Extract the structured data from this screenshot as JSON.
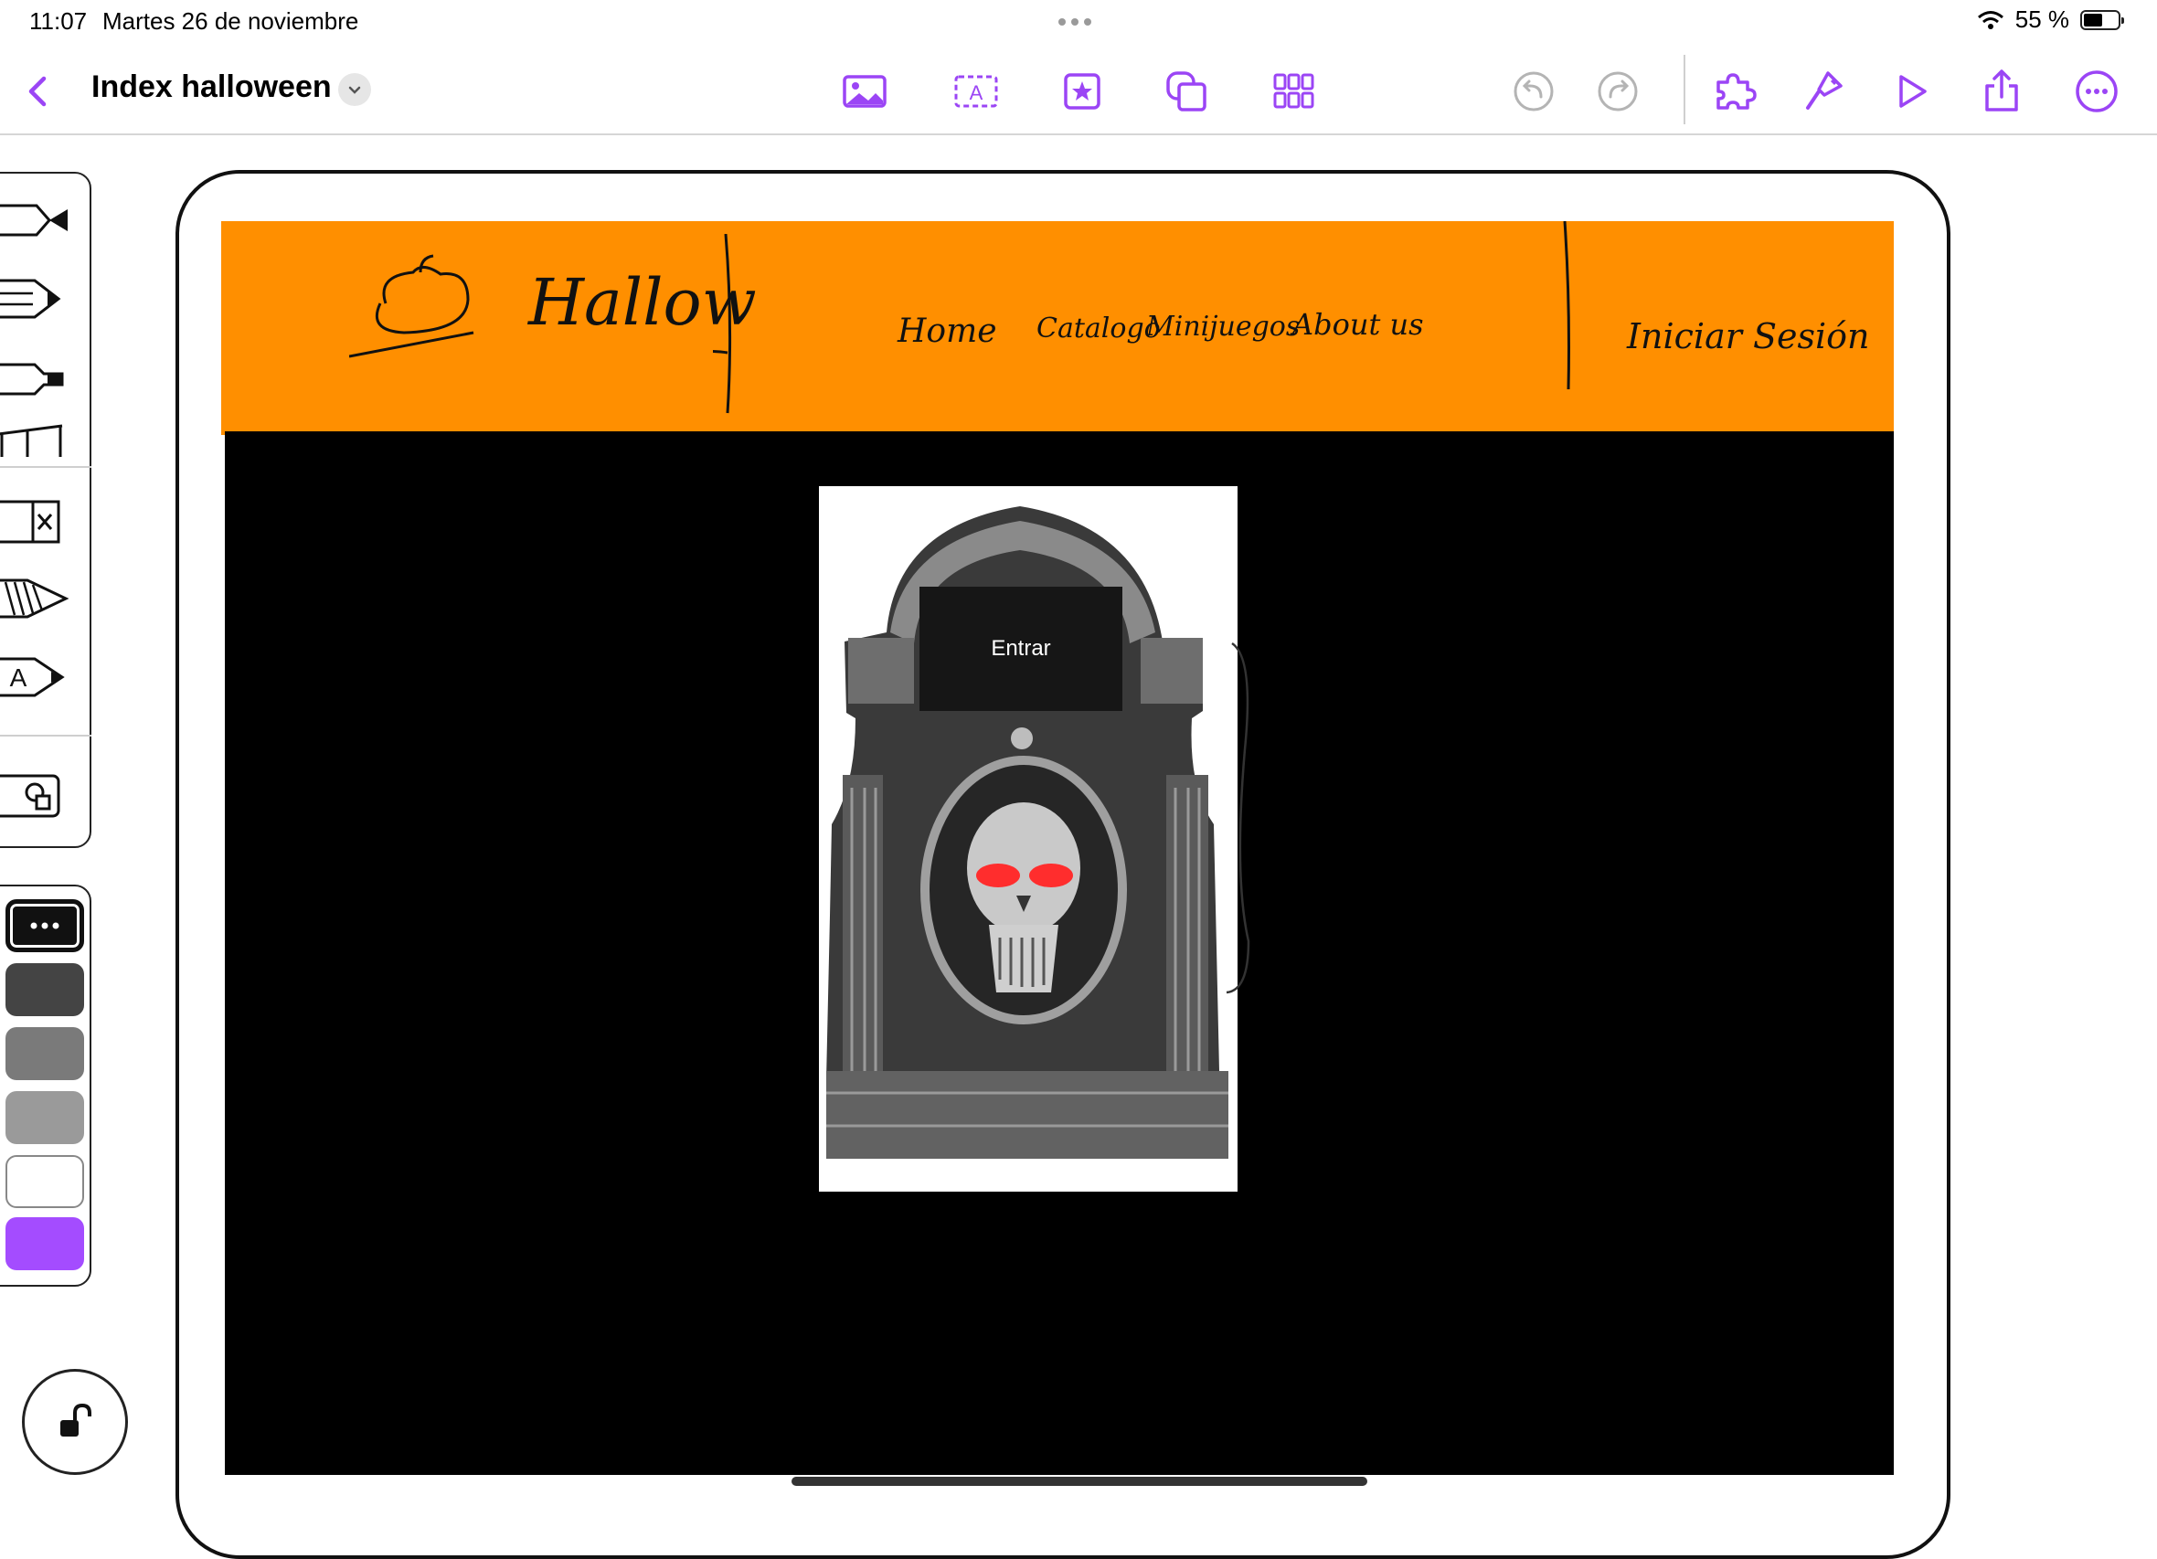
{
  "status_bar": {
    "time": "11:07",
    "date": "Martes 26 de noviembre",
    "battery": "55 %",
    "battery_level": 0.55
  },
  "toolbar": {
    "back_icon": "chevron-left-icon",
    "document_title": "Index halloween",
    "title_menu_icon": "chevron-down-icon",
    "tools": [
      "image-icon",
      "text-box-icon",
      "star-icon",
      "shapes-icon",
      "grid-icon"
    ],
    "actions": [
      "undo-icon",
      "redo-icon",
      "puzzle-icon",
      "paintbrush-icon",
      "play-icon",
      "share-icon",
      "more-icon"
    ],
    "accent_color": "#9b45f5"
  },
  "palette": {
    "tools": [
      "pen-tool-icon",
      "pencil-tool-icon",
      "marker-tool-icon",
      "ruler-tool-icon",
      "eraser-tool-icon",
      "crayon-tool-icon",
      "text-pen-tool-icon",
      "shape-tool-icon"
    ],
    "colors": [
      "#111111",
      "#444444",
      "#7a7a7a",
      "#9a9a9a",
      "#ffffff",
      "#a44cff"
    ],
    "more_colors_icon": "more-dots-icon",
    "lock_icon": "unlock-icon"
  },
  "canvas": {
    "header_color": "#ff8f00",
    "logo_text": "Hallow",
    "nav": [
      "Home",
      "Catalogo",
      "Minijuegos",
      "About us"
    ],
    "login": "Iniciar Sesión",
    "tombstone_image": "tombstone-skull-image",
    "enter_button": "Entrar"
  }
}
